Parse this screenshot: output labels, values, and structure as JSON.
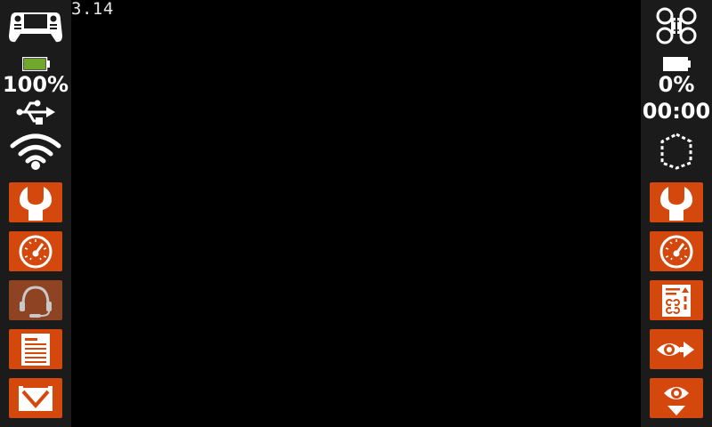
{
  "app": {
    "version": "3.14"
  },
  "left_panel": {
    "battery_percent": "100%",
    "battery_level": 1.0,
    "battery_color": "#6fa82b",
    "icons": [
      "gamepad-icon",
      "battery-icon",
      "usb-icon",
      "wifi-icon"
    ],
    "buttons": [
      "wrench-icon",
      "gauge-icon",
      "headset-icon",
      "document-icon",
      "envelope-icon"
    ]
  },
  "right_panel": {
    "battery_percent": "0%",
    "flight_timer": "00:00",
    "battery_level": 0.0,
    "icons": [
      "drone-icon",
      "battery-icon",
      "disconnected-icon"
    ],
    "buttons": [
      "wrench-icon",
      "gauge-icon",
      "drone-checklist-icon",
      "eye-forward-icon",
      "eye-down-icon"
    ]
  },
  "colors": {
    "accent": "#d4480e",
    "accent_dim": "#8e4423",
    "sidebar_bg": "#1b1b1b",
    "background": "#000000"
  }
}
